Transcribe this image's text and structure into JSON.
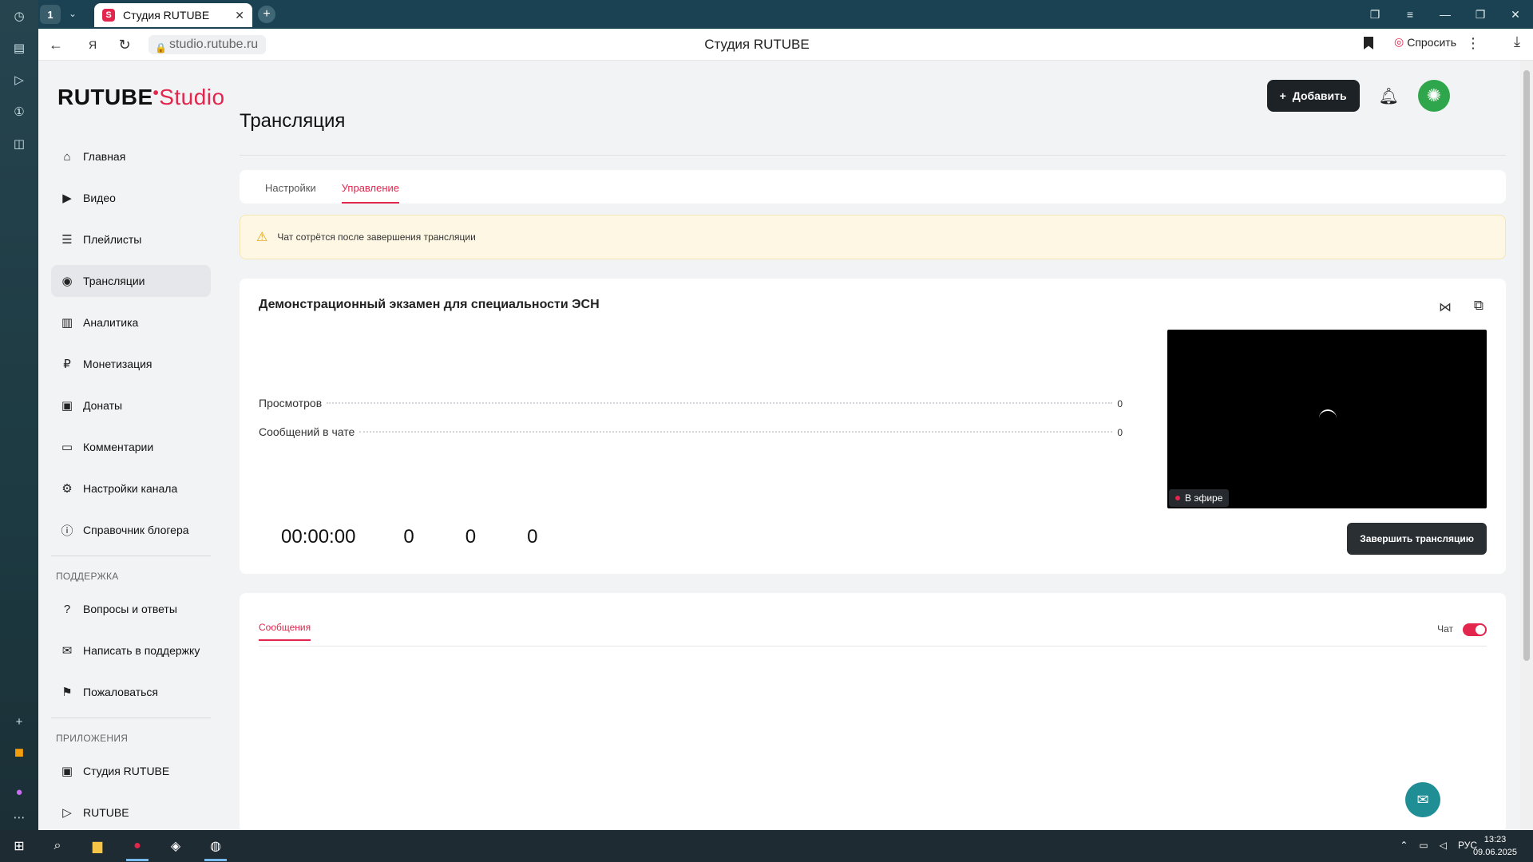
{
  "browser": {
    "tab_count": "1",
    "tab_title": "Студия RUTUBE",
    "tab_favicon_letter": "S",
    "url": "studio.rutube.ru",
    "page_title": "Студия RUTUBE",
    "ask_label": "Спросить"
  },
  "app": {
    "logo_brand": "RUTUBE",
    "logo_studio": "Studio",
    "add_label": "Добавить",
    "accent_color": "#e2264d"
  },
  "sidebar": {
    "items": [
      {
        "label": "Главная",
        "icon": "home-icon"
      },
      {
        "label": "Видео",
        "icon": "video-icon"
      },
      {
        "label": "Плейлисты",
        "icon": "list-icon"
      },
      {
        "label": "Трансляции",
        "icon": "broadcast-icon",
        "active": true
      },
      {
        "label": "Аналитика",
        "icon": "chart-icon"
      },
      {
        "label": "Монетизация",
        "icon": "ruble-icon"
      },
      {
        "label": "Донаты",
        "icon": "wallet-icon"
      },
      {
        "label": "Комментарии",
        "icon": "comment-icon"
      },
      {
        "label": "Настройки канала",
        "icon": "gear-icon"
      },
      {
        "label": "Справочник блогера",
        "icon": "info-icon"
      }
    ],
    "support_header": "ПОДДЕРЖКА",
    "support_items": [
      {
        "label": "Вопросы и ответы",
        "icon": "question-icon"
      },
      {
        "label": "Написать в поддержку",
        "icon": "mail-icon"
      },
      {
        "label": "Пожаловаться",
        "icon": "flag-icon"
      }
    ],
    "apps_header": "ПРИЛОЖЕНИЯ",
    "apps_items": [
      {
        "label": "Студия RUTUBE",
        "icon": "studio-icon"
      },
      {
        "label": "RUTUBE",
        "icon": "rutube-icon"
      }
    ]
  },
  "main": {
    "title": "Трансляция",
    "tabs": [
      {
        "label": "Настройки"
      },
      {
        "label": "Управление",
        "active": true
      }
    ],
    "warning": "Чат сотрётся после завершения трансляции",
    "stream": {
      "title": "Демонстрационный экзамен для специальности ЭСН",
      "stats": [
        {
          "label": "Просмотров",
          "value": "0"
        },
        {
          "label": "Сообщений в чате",
          "value": "0"
        }
      ],
      "timer": "00:00:00",
      "counters": [
        "0",
        "0",
        "0"
      ],
      "live_label": "В эфире",
      "end_button": "Завершить трансляцию"
    },
    "chat": {
      "tab_label": "Сообщения",
      "toggle_label": "Чат",
      "toggle_on": true
    }
  },
  "taskbar": {
    "lang": "РУС",
    "time": "13:23",
    "date": "09.06.2025"
  }
}
